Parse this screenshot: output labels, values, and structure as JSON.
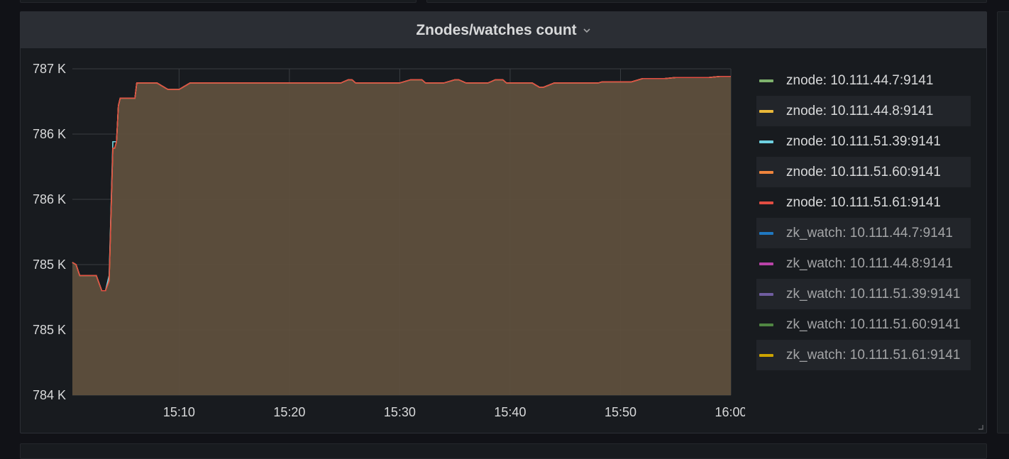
{
  "panel": {
    "title": "Znodes/watches count"
  },
  "colors": {
    "background": "#111217",
    "panel": "#181b1f",
    "header": "#2b2e34",
    "fill": "#5e4f3d",
    "grid": "#3a3d42",
    "text": "#d8d9da"
  },
  "chart_data": {
    "type": "area",
    "title": "Znodes/watches count",
    "xlabel": "",
    "ylabel": "",
    "x_tick_labels": [
      "15:10",
      "15:20",
      "15:30",
      "15:40",
      "15:50",
      "16:00"
    ],
    "y_tick_labels": [
      "784 K",
      "785 K",
      "785 K",
      "786 K",
      "786 K",
      "787 K"
    ],
    "ylim": [
      784000,
      787000
    ],
    "xlim": [
      "15:00:20",
      "16:00:00"
    ],
    "grid": true,
    "legend_position": "right",
    "x": [
      "15:00:20",
      "15:00:40",
      "15:01:00",
      "15:01:20",
      "15:01:40",
      "15:02:00",
      "15:02:30",
      "15:03:00",
      "15:03:20",
      "15:03:40",
      "15:04:00",
      "15:04:10",
      "15:04:20",
      "15:04:30",
      "15:04:40",
      "15:05:00",
      "15:05:10",
      "15:05:30",
      "15:06:00",
      "15:06:10",
      "15:06:20",
      "15:06:40",
      "15:07:00",
      "15:08:00",
      "15:09:00",
      "15:10:00",
      "15:11:00",
      "15:12:00",
      "15:14:00",
      "15:16:00",
      "15:18:00",
      "15:20:00",
      "15:22:00",
      "15:24:00",
      "15:24:40",
      "15:25:20",
      "15:25:40",
      "15:26:00",
      "15:28:00",
      "15:30:00",
      "15:31:00",
      "15:32:00",
      "15:32:20",
      "15:33:00",
      "15:34:00",
      "15:35:00",
      "15:35:20",
      "15:36:00",
      "15:38:00",
      "15:38:40",
      "15:39:20",
      "15:39:40",
      "15:40:00",
      "15:41:00",
      "15:42:00",
      "15:42:40",
      "15:43:00",
      "15:44:00",
      "15:45:00",
      "15:46:00",
      "15:47:00",
      "15:48:00",
      "15:48:20",
      "15:49:00",
      "15:50:00",
      "15:50:40",
      "15:51:00",
      "15:52:00",
      "15:53:00",
      "15:53:20",
      "15:54:00",
      "15:55:00",
      "15:56:00",
      "15:57:00",
      "15:58:00",
      "15:59:00",
      "15:59:20",
      "16:00:00"
    ],
    "series": [
      {
        "name": "znode: 10.111.44.7:9141",
        "color": "#7eb26d",
        "values": [
          785220,
          785200,
          785100,
          785100,
          785100,
          785100,
          785100,
          784960,
          784960,
          785100,
          786330,
          786330,
          786330,
          786660,
          786730,
          786730,
          786730,
          786730,
          786730,
          786870,
          786870,
          786870,
          786870,
          786870,
          786810,
          786810,
          786870,
          786870,
          786870,
          786870,
          786870,
          786870,
          786870,
          786870,
          786870,
          786900,
          786900,
          786870,
          786870,
          786870,
          786900,
          786900,
          786870,
          786870,
          786870,
          786900,
          786900,
          786870,
          786870,
          786900,
          786900,
          786870,
          786870,
          786870,
          786870,
          786830,
          786830,
          786870,
          786870,
          786870,
          786870,
          786870,
          786880,
          786880,
          786880,
          786880,
          786880,
          786910,
          786910,
          786910,
          786910,
          786920,
          786920,
          786920,
          786920,
          786930,
          786930,
          786930
        ]
      },
      {
        "name": "znode: 10.111.44.8:9141",
        "color": "#eab839",
        "values": [
          785220,
          785200,
          785100,
          785100,
          785100,
          785100,
          785100,
          784960,
          784960,
          785050,
          786270,
          786270,
          786330,
          786660,
          786730,
          786730,
          786730,
          786730,
          786730,
          786870,
          786870,
          786870,
          786870,
          786870,
          786810,
          786810,
          786870,
          786870,
          786870,
          786870,
          786870,
          786870,
          786870,
          786870,
          786870,
          786900,
          786900,
          786870,
          786870,
          786870,
          786900,
          786900,
          786870,
          786870,
          786870,
          786900,
          786900,
          786870,
          786870,
          786900,
          786900,
          786870,
          786870,
          786870,
          786870,
          786830,
          786830,
          786870,
          786870,
          786870,
          786870,
          786870,
          786880,
          786880,
          786880,
          786880,
          786880,
          786910,
          786910,
          786910,
          786910,
          786920,
          786920,
          786920,
          786920,
          786930,
          786930,
          786930
        ]
      },
      {
        "name": "znode: 10.111.51.39:9141",
        "color": "#6ed0e0",
        "values": [
          785220,
          785200,
          785100,
          785100,
          785100,
          785100,
          785100,
          784960,
          784960,
          785100,
          786330,
          786330,
          786330,
          786660,
          786730,
          786730,
          786730,
          786730,
          786730,
          786870,
          786870,
          786870,
          786870,
          786870,
          786810,
          786810,
          786870,
          786870,
          786870,
          786870,
          786870,
          786870,
          786870,
          786870,
          786870,
          786900,
          786900,
          786870,
          786870,
          786870,
          786900,
          786900,
          786870,
          786870,
          786870,
          786900,
          786900,
          786870,
          786870,
          786900,
          786900,
          786870,
          786870,
          786870,
          786870,
          786830,
          786830,
          786870,
          786870,
          786870,
          786870,
          786870,
          786880,
          786880,
          786880,
          786880,
          786880,
          786910,
          786910,
          786910,
          786910,
          786920,
          786920,
          786920,
          786920,
          786930,
          786930,
          786930
        ]
      },
      {
        "name": "znode: 10.111.51.60:9141",
        "color": "#ef843c",
        "values": [
          785220,
          785200,
          785100,
          785100,
          785100,
          785100,
          785100,
          784960,
          784960,
          785050,
          786270,
          786270,
          786330,
          786660,
          786730,
          786730,
          786730,
          786730,
          786730,
          786870,
          786870,
          786870,
          786870,
          786870,
          786810,
          786810,
          786870,
          786870,
          786870,
          786870,
          786870,
          786870,
          786870,
          786870,
          786870,
          786900,
          786900,
          786870,
          786870,
          786870,
          786900,
          786900,
          786870,
          786870,
          786870,
          786900,
          786900,
          786870,
          786870,
          786900,
          786900,
          786870,
          786870,
          786870,
          786870,
          786830,
          786830,
          786870,
          786870,
          786870,
          786870,
          786870,
          786880,
          786880,
          786880,
          786880,
          786880,
          786910,
          786910,
          786910,
          786910,
          786920,
          786920,
          786920,
          786920,
          786930,
          786930,
          786930
        ]
      },
      {
        "name": "znode: 10.111.51.61:9141",
        "color": "#e24d42",
        "values": [
          785220,
          785200,
          785100,
          785100,
          785100,
          785100,
          785100,
          784960,
          784960,
          785050,
          786270,
          786270,
          786330,
          786660,
          786730,
          786730,
          786730,
          786730,
          786730,
          786870,
          786870,
          786870,
          786870,
          786870,
          786810,
          786810,
          786870,
          786870,
          786870,
          786870,
          786870,
          786870,
          786870,
          786870,
          786870,
          786900,
          786900,
          786870,
          786870,
          786870,
          786900,
          786900,
          786870,
          786870,
          786870,
          786900,
          786900,
          786870,
          786870,
          786900,
          786900,
          786870,
          786870,
          786870,
          786870,
          786830,
          786830,
          786870,
          786870,
          786870,
          786870,
          786870,
          786880,
          786880,
          786880,
          786880,
          786880,
          786910,
          786910,
          786910,
          786910,
          786920,
          786920,
          786920,
          786920,
          786930,
          786930,
          786930
        ]
      }
    ],
    "legend": [
      {
        "name": "znode: 10.111.44.7:9141",
        "color": "#7eb26d"
      },
      {
        "name": "znode: 10.111.44.8:9141",
        "color": "#eab839"
      },
      {
        "name": "znode: 10.111.51.39:9141",
        "color": "#6ed0e0"
      },
      {
        "name": "znode: 10.111.51.60:9141",
        "color": "#ef843c"
      },
      {
        "name": "znode: 10.111.51.61:9141",
        "color": "#e24d42"
      },
      {
        "name": "zk_watch: 10.111.44.7:9141",
        "color": "#1f78c1"
      },
      {
        "name": "zk_watch: 10.111.44.8:9141",
        "color": "#ba43a9"
      },
      {
        "name": "zk_watch: 10.111.51.39:9141",
        "color": "#705da0"
      },
      {
        "name": "zk_watch: 10.111.51.60:9141",
        "color": "#508642"
      },
      {
        "name": "zk_watch: 10.111.51.61:9141",
        "color": "#cca300"
      }
    ]
  }
}
